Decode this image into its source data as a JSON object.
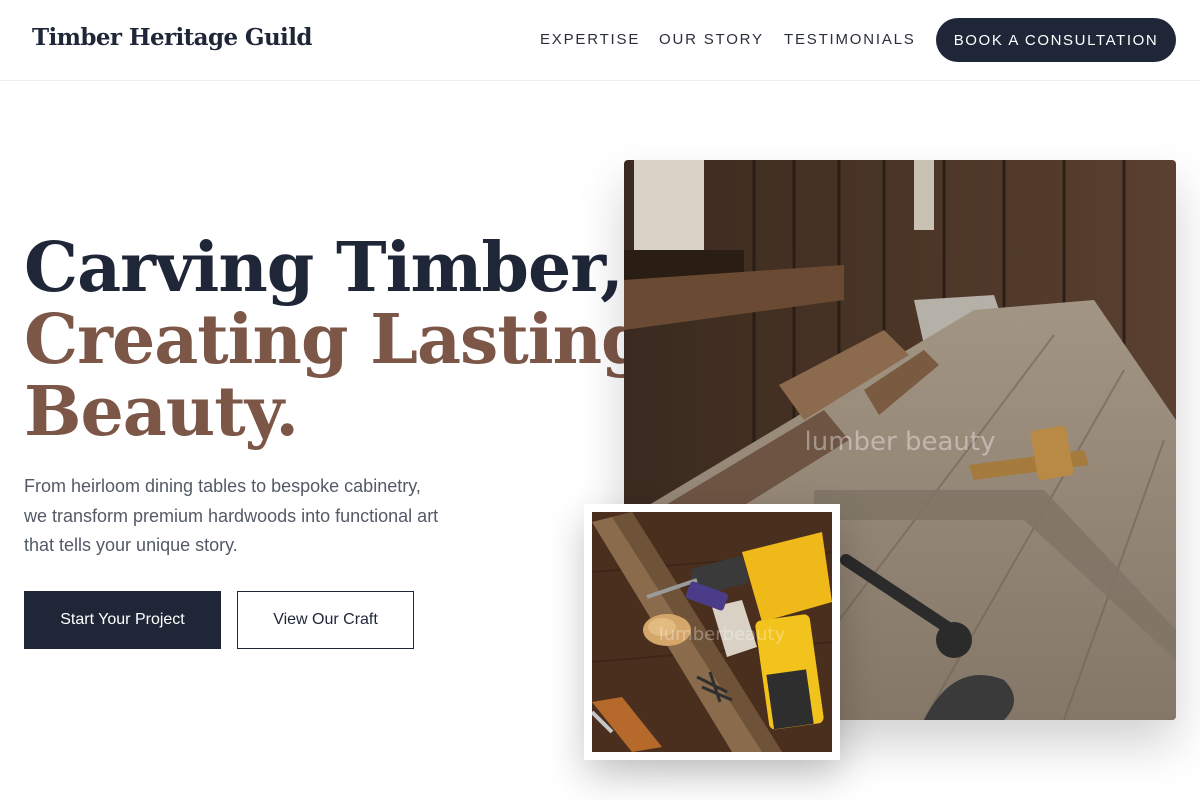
{
  "header": {
    "brand": "Timber Heritage Guild",
    "nav": [
      "EXPERTISE",
      "OUR STORY",
      "TESTIMONIALS"
    ],
    "cta_label": "BOOK A CONSULTATION"
  },
  "hero": {
    "headline_line1": "Carving Timber,",
    "headline_line2": "Creating Lasting",
    "headline_line3": "Beauty.",
    "intro_line1": "From heirloom dining tables to bespoke cabinetry,",
    "intro_line2": "we transform premium hardwoods into functional art",
    "intro_line3": "that tells your unique story.",
    "primary_button": "Start Your Project",
    "secondary_button": "View Our Craft"
  },
  "images": {
    "main_watermark": "lumber beauty",
    "small_watermark": "lumberbeauty"
  },
  "colors": {
    "navy": "#1e2638",
    "brown_accent": "#7c5647",
    "body_text": "#535a66"
  }
}
